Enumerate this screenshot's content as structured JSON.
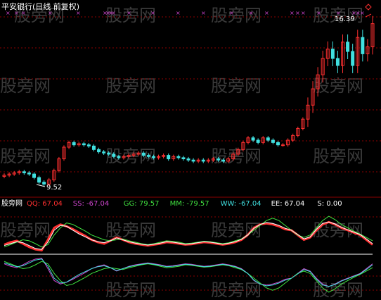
{
  "header": {
    "title": "平安银行(日线 前复权)",
    "title_color": "#ffffff"
  },
  "colors": {
    "background": "#000000",
    "grid": "#8b0000",
    "up_candle": "#ff3030",
    "down_candle": "#40e0e0",
    "marker": "#cc44cc",
    "watermark": "#3a3a3a"
  },
  "watermark": {
    "text": "股旁网"
  },
  "price_panel": {
    "high_label": "16.39",
    "low_label": "9.52"
  },
  "indicator_panel": {
    "name": "股旁网",
    "legend": [
      {
        "key": "QQ",
        "text": "QQ: 67.04",
        "color": "#ff3030"
      },
      {
        "key": "SS",
        "text": "SS: -67.04",
        "color": "#cc44cc"
      },
      {
        "key": "GG",
        "text": "GG: 79.57",
        "color": "#40e040"
      },
      {
        "key": "MM",
        "text": "MM: -79.57",
        "color": "#40e040"
      },
      {
        "key": "WW",
        "text": "WW: -67.04",
        "color": "#40e0e0"
      },
      {
        "key": "EE",
        "text": "EE: 67.04",
        "color": "#ffffff"
      },
      {
        "key": "S",
        "text": "S: 0.00",
        "color": "#ffffff"
      }
    ]
  },
  "chart_data": [
    {
      "type": "candlestick",
      "title": "平安银行(日线 前复权)",
      "annotations": [
        "16.39",
        "9.52"
      ],
      "ylim": [
        9.2,
        16.8
      ],
      "series": [
        {
          "name": "close",
          "values": [
            9.9,
            9.95,
            10.0,
            10.05,
            10.0,
            9.95,
            9.8,
            9.6,
            9.52,
            9.7,
            10.1,
            10.6,
            11.1,
            11.3,
            11.2,
            11.25,
            11.2,
            11.15,
            11.0,
            10.9,
            10.85,
            10.8,
            10.7,
            10.65,
            10.7,
            10.75,
            10.8,
            10.85,
            10.75,
            10.7,
            10.65,
            10.7,
            10.75,
            10.6,
            10.7,
            10.65,
            10.6,
            10.55,
            10.5,
            10.55,
            10.5,
            10.55,
            10.6,
            10.55,
            10.5,
            10.6,
            10.8,
            11.0,
            11.3,
            11.5,
            11.4,
            11.3,
            11.5,
            11.4,
            11.3,
            11.2,
            11.2,
            11.4,
            11.6,
            11.9,
            12.3,
            12.9,
            13.6,
            14.2,
            14.9,
            15.3,
            14.9,
            14.6,
            15.6,
            15.2,
            14.6,
            15.8,
            15.1,
            15.4,
            16.39
          ]
        }
      ]
    },
    {
      "type": "line",
      "title": "股旁网",
      "series": [
        {
          "name": "QQ",
          "values": [
            20,
            25,
            28,
            22,
            15,
            10,
            8,
            30,
            55,
            62,
            58,
            52,
            45,
            38,
            30,
            25,
            22,
            28,
            35,
            30,
            25,
            22,
            20,
            18,
            20,
            22,
            25,
            24,
            22,
            20,
            21,
            23,
            25,
            24,
            22,
            20,
            22,
            25,
            30,
            40,
            55,
            62,
            64,
            62,
            58,
            52,
            50,
            40,
            30,
            35,
            50,
            62,
            67,
            62,
            55,
            50,
            45,
            40,
            30,
            20
          ]
        },
        {
          "name": "SS",
          "values": [
            -20,
            -25,
            -28,
            -22,
            -15,
            -10,
            -8,
            -30,
            -55,
            -62,
            -58,
            -52,
            -45,
            -38,
            -30,
            -25,
            -22,
            -28,
            -35,
            -30,
            -25,
            -22,
            -20,
            -18,
            -20,
            -22,
            -25,
            -24,
            -22,
            -20,
            -21,
            -23,
            -25,
            -24,
            -22,
            -20,
            -22,
            -25,
            -30,
            -40,
            -55,
            -62,
            -64,
            -62,
            -58,
            -52,
            -50,
            -40,
            -30,
            -35,
            -50,
            -62,
            -67,
            -62,
            -55,
            -50,
            -45,
            -40,
            -30,
            -20
          ]
        },
        {
          "name": "GG",
          "values": [
            15,
            20,
            25,
            30,
            28,
            22,
            15,
            20,
            40,
            55,
            65,
            62,
            55,
            48,
            40,
            35,
            30,
            28,
            30,
            32,
            28,
            25,
            22,
            20,
            22,
            25,
            28,
            27,
            25,
            22,
            23,
            25,
            27,
            26,
            24,
            22,
            24,
            28,
            32,
            40,
            50,
            60,
            70,
            75,
            70,
            60,
            50,
            40,
            35,
            40,
            55,
            70,
            79,
            72,
            62,
            55,
            48,
            42,
            35,
            28
          ]
        },
        {
          "name": "MM",
          "values": [
            -15,
            -20,
            -25,
            -30,
            -28,
            -22,
            -15,
            -20,
            -40,
            -55,
            -65,
            -62,
            -55,
            -48,
            -40,
            -35,
            -30,
            -28,
            -30,
            -32,
            -28,
            -25,
            -22,
            -20,
            -22,
            -25,
            -28,
            -27,
            -25,
            -22,
            -23,
            -25,
            -27,
            -26,
            -24,
            -22,
            -24,
            -28,
            -32,
            -40,
            -50,
            -60,
            -70,
            -75,
            -70,
            -60,
            -50,
            -40,
            -35,
            -40,
            -55,
            -70,
            -79,
            -72,
            -62,
            -55,
            -48,
            -42,
            -35,
            -28
          ]
        },
        {
          "name": "EE",
          "values": [
            18,
            22,
            26,
            24,
            18,
            12,
            10,
            25,
            50,
            60,
            58,
            50,
            42,
            36,
            30,
            26,
            24,
            28,
            34,
            30,
            26,
            23,
            21,
            19,
            21,
            23,
            26,
            25,
            23,
            21,
            22,
            24,
            26,
            25,
            23,
            21,
            23,
            26,
            31,
            40,
            54,
            62,
            66,
            64,
            60,
            54,
            50,
            41,
            32,
            36,
            52,
            64,
            67,
            63,
            56,
            51,
            46,
            41,
            32,
            22
          ]
        },
        {
          "name": "WW",
          "values": [
            -18,
            -22,
            -26,
            -24,
            -18,
            -12,
            -10,
            -25,
            -50,
            -60,
            -58,
            -50,
            -42,
            -36,
            -30,
            -26,
            -24,
            -28,
            -34,
            -30,
            -26,
            -23,
            -21,
            -19,
            -21,
            -23,
            -26,
            -25,
            -23,
            -21,
            -22,
            -24,
            -26,
            -25,
            -23,
            -21,
            -23,
            -26,
            -31,
            -40,
            -54,
            -62,
            -66,
            -64,
            -60,
            -54,
            -50,
            -41,
            -32,
            -36,
            -52,
            -64,
            -67,
            -63,
            -56,
            -51,
            -46,
            -41,
            -32,
            -22
          ]
        },
        {
          "name": "S",
          "values": [
            0
          ]
        }
      ]
    }
  ]
}
